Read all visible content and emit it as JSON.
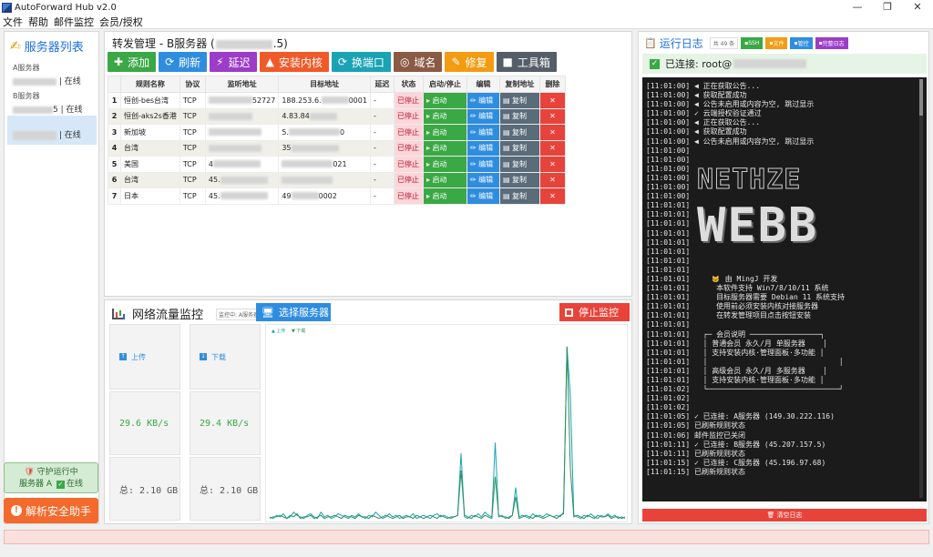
{
  "window": {
    "title": "AutoForward Hub v2.0",
    "min": "—",
    "max": "❐",
    "close": "✕"
  },
  "menu": [
    "文件",
    "帮助",
    "邮件监控",
    "会员/授权"
  ],
  "sidebar": {
    "title": "服务器列表",
    "servers": [
      {
        "name": "A服务器",
        "status": "| 在线"
      },
      {
        "name": "B服务器",
        "status": "5 | 在线"
      },
      {
        "name": "",
        "status": "| 在线"
      }
    ],
    "guard_line1": "守护运行中",
    "guard_line2": "服务器 A",
    "guard_line3": "在线",
    "assist": "解析安全助手"
  },
  "forward": {
    "title": "转发管理 - B服务器 (",
    "title_tail": ".5)",
    "toolbar": [
      {
        "label": "添加",
        "icon": "✚",
        "color": "#3aa845",
        "name": "add-button"
      },
      {
        "label": "刷新",
        "icon": "⟳",
        "color": "#2f8de0",
        "name": "refresh-button"
      },
      {
        "label": "延迟",
        "icon": "⚡",
        "color": "#9c3cc8",
        "name": "latency-button"
      },
      {
        "label": "安装内核",
        "icon": "▲",
        "color": "#f05a28",
        "name": "install-kernel-button"
      },
      {
        "label": "换端口",
        "icon": "⟳",
        "color": "#1aa3b5",
        "name": "change-port-button"
      },
      {
        "label": "域名",
        "icon": "◎",
        "color": "#8a5a44",
        "name": "domain-button"
      },
      {
        "label": "修复",
        "icon": "✎",
        "color": "#f39c12",
        "name": "repair-button"
      },
      {
        "label": "工具箱",
        "icon": "■",
        "color": "#555e68",
        "name": "toolbox-button"
      }
    ],
    "columns": [
      "",
      "规则名称",
      "协议",
      "监听地址",
      "目标地址",
      "延迟",
      "状态",
      "启动/停止",
      "编辑",
      "复制地址",
      "删除"
    ],
    "rows": [
      {
        "n": "1",
        "name": "恒创-bes台湾",
        "proto": "TCP",
        "listen": "52727",
        "target": "188.253.6.",
        "target_tail": "0001",
        "delay": "-",
        "status": "已停止",
        "start": "▸ 启动",
        "edit": "✏ 编辑",
        "copy": "▤ 复制",
        "del": "✕"
      },
      {
        "n": "2",
        "name": "恒创-aks2s香港",
        "proto": "TCP",
        "listen": "",
        "target": "4.83.84",
        "target_tail": "",
        "delay": "-",
        "status": "已停止",
        "start": "▸ 启动",
        "edit": "✏ 编辑",
        "copy": "▤ 复制",
        "del": "✕"
      },
      {
        "n": "3",
        "name": "新加坡",
        "proto": "TCP",
        "listen": "",
        "target": "5.",
        "target_tail": "0",
        "delay": "-",
        "status": "已停止",
        "start": "▸ 启动",
        "edit": "✏ 编辑",
        "copy": "▤ 复制",
        "del": "✕"
      },
      {
        "n": "4",
        "name": "台湾",
        "proto": "TCP",
        "listen": "",
        "target": "35",
        "target_tail": "",
        "delay": "-",
        "status": "已停止",
        "start": "▸ 启动",
        "edit": "✏ 编辑",
        "copy": "▤ 复制",
        "del": "✕"
      },
      {
        "n": "5",
        "name": "美国",
        "proto": "TCP",
        "listen": "4",
        "target": "",
        "target_tail": "021",
        "delay": "-",
        "status": "已停止",
        "start": "▸ 启动",
        "edit": "✏ 编辑",
        "copy": "▤ 复制",
        "del": "✕"
      },
      {
        "n": "6",
        "name": "台湾",
        "proto": "TCP",
        "listen": "45.",
        "target": "",
        "target_tail": "",
        "delay": "-",
        "status": "已停止",
        "start": "▸ 启动",
        "edit": "✏ 编辑",
        "copy": "▤ 复制",
        "del": "✕"
      },
      {
        "n": "7",
        "name": "日本",
        "proto": "TCP",
        "listen": "45.",
        "target": "49",
        "target_tail": "0002",
        "delay": "-",
        "status": "已停止",
        "start": "▸ 启动",
        "edit": "✏ 编辑",
        "copy": "▤ 复制",
        "del": "✕"
      }
    ]
  },
  "monitor": {
    "title": "网络流量监控",
    "current": "监控中: A服务器",
    "select": "选择服务器",
    "stop": "停止监控",
    "upload_label": "上传",
    "download_label": "下载",
    "upload_rate": "29.6 KB/s",
    "download_rate": "29.4 KB/s",
    "upload_total": "总: 2.10 GB",
    "download_total": "总: 2.10 GB",
    "legend_up": "▲ 上传",
    "legend_down": "▼ 下载",
    "chart_data": {
      "type": "line",
      "series": [
        {
          "name": "上传",
          "color": "#1aa3b5",
          "values": [
            0.3,
            0.2,
            0.4,
            0.3,
            0.5,
            0.2,
            0.3,
            0.6,
            0.4,
            0.3,
            0.2,
            0.4,
            0.5,
            0.3,
            0.2,
            0.6,
            0.3,
            0.4,
            0.2,
            0.3,
            0.5,
            0.4,
            0.3,
            0.2,
            0.4,
            0.3,
            0.5,
            0.3,
            0.2,
            0.4,
            0.3,
            0.6,
            0.4,
            0.2,
            0.3,
            0.5,
            0.3,
            0.4,
            0.2,
            0.3,
            0.4,
            0.3,
            0.5,
            0.2,
            0.3,
            0.4,
            0.3,
            0.2,
            0.4,
            0.5,
            0.3,
            0.4,
            0.3,
            0.2,
            0.3,
            0.4,
            4.4,
            0.3,
            0.2,
            0.4,
            0.3,
            0.5,
            0.3,
            0.6,
            0.4,
            0.3,
            5.1,
            0.3,
            0.4,
            0.2,
            0.3,
            0.4,
            2.2,
            0.3,
            0.4,
            0.3,
            0.2,
            0.5,
            0.3,
            0.4,
            0.3,
            0.5,
            0.4,
            0.3,
            0.4,
            0.3,
            0.6,
            11.3,
            8.1,
            0.4,
            0.3,
            0.2,
            0.4,
            0.3,
            0.5,
            0.3,
            0.2,
            0.4,
            0.3,
            0.5,
            0.3,
            0.4,
            0.2,
            0.3,
            0.2
          ]
        },
        {
          "name": "下载",
          "color": "#2d8f5a",
          "values": [
            0.2,
            0.3,
            0.3,
            0.4,
            0.3,
            0.2,
            0.4,
            0.3,
            0.5,
            0.2,
            0.3,
            0.3,
            0.4,
            0.2,
            0.3,
            0.4,
            0.2,
            0.3,
            0.3,
            0.4,
            0.3,
            0.2,
            0.4,
            0.3,
            0.3,
            0.2,
            0.4,
            0.3,
            0.3,
            0.2,
            0.4,
            0.3,
            0.2,
            0.3,
            0.4,
            0.3,
            0.2,
            0.3,
            0.4,
            0.2,
            0.3,
            0.3,
            0.2,
            0.4,
            0.3,
            0.2,
            0.3,
            0.4,
            0.3,
            0.2,
            0.4,
            0.3,
            0.2,
            0.3,
            0.3,
            0.4,
            3.3,
            0.4,
            0.3,
            0.2,
            0.4,
            0.3,
            0.2,
            0.4,
            0.3,
            0.2,
            2.9,
            0.4,
            0.3,
            0.3,
            0.2,
            0.4,
            1.6,
            0.2,
            0.3,
            0.4,
            0.3,
            0.2,
            0.4,
            0.3,
            0.2,
            0.3,
            0.4,
            0.3,
            0.2,
            0.4,
            0.5,
            11.3,
            3.4,
            0.3,
            0.4,
            0.3,
            0.2,
            0.4,
            0.3,
            0.2,
            0.4,
            0.3,
            0.3,
            0.4,
            0.2,
            0.3,
            0.3,
            0.2,
            0.3
          ]
        }
      ]
    }
  },
  "log": {
    "title": "运行日志",
    "count": "共 49 条",
    "buttons": [
      {
        "label": "SSH",
        "color": "#3aa845"
      },
      {
        "label": "文件",
        "color": "#f39c12"
      },
      {
        "label": "管控",
        "color": "#2f8de0"
      },
      {
        "label": "完整日志",
        "color": "#9c3cc8"
      }
    ],
    "connected": "已连接: root@",
    "clear": "清空日志",
    "lines": [
      "[11:01:00] ◀ 正在获取公告...",
      "[11:01:00] ◀ 获取配置成功",
      "[11:01:00] ◀ 公告未启用或内容为空, 跳过显示",
      "[11:01:00] ✓ 云端授权验证通过",
      "[11:01:00] ◀ 正在获取公告...",
      "[11:01:00] ◀ 获取配置成功",
      "[11:01:00] ◀ 公告未启用或内容为空, 跳过显示",
      "[11:01:00]",
      "[11:01:00]",
      "[11:01:00]",
      "[11:01:00]",
      "[11:01:00]",
      "[11:01:00]",
      "[11:01:01]",
      "[11:01:01]",
      "[11:01:01]",
      "[11:01:01]",
      "[11:01:01]",
      "[11:01:01]",
      "[11:01:01]",
      "[11:01:01]",
      "[11:01:01]        由 MingJ 开发",
      "[11:01:01]      本软件支持 Win7/8/10/11 系统",
      "[11:01:01]      目标服务器需要 Debian 11 系统支持",
      "[11:01:01]      使用前必须安装内核对接服务器",
      "[11:01:01]      在转发管理项目点击按钮安装",
      "[11:01:01]",
      "[11:01:01]   ┌─ 会员说明 ────────────────┐",
      "[11:01:01]   │ 普通会员 永久/月 单服务器    │",
      "[11:01:01]   │ 支持安装内核·管理面板·多功能 │",
      "[11:01:01]   │                              │",
      "[11:01:01]   │ 高级会员 永久/月 多服务器    │",
      "[11:01:01]   │ 支持安装内核·管理面板·多功能 │",
      "[11:01:02]   └──────────────────────────────┘",
      "[11:01:02]",
      "[11:01:02]",
      "[11:01:05] ✓ 已连接: A服务器 (149.30.222.116)",
      "[11:01:05] 已刷新规则状态",
      "[11:01:06] 邮件监控已关闭",
      "[11:01:11] ✓ 已连接: B服务器 (45.207.157.5)",
      "[11:01:11] 已刷新规则状态",
      "[11:01:15] ✓ 已连接: C服务器 (45.196.97.68)",
      "[11:01:15] 已刷新规则状态"
    ],
    "banner_top": "NETHZE",
    "banner_mid": "WEBB"
  }
}
